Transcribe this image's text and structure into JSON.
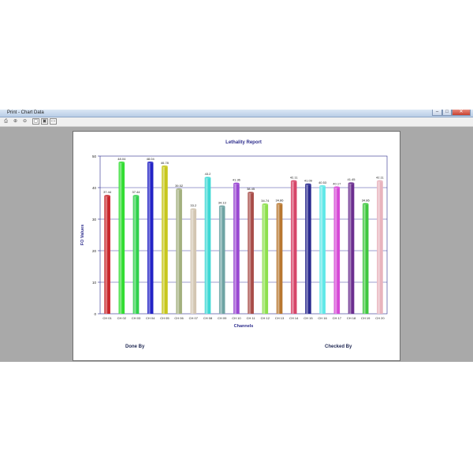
{
  "window": {
    "title": "Print - Chart Data"
  },
  "caption_buttons": {
    "minimize": "–",
    "maximize": "□",
    "close": "✕"
  },
  "toolbar": {
    "buttons": [
      {
        "name": "print-icon",
        "glyph": "⎙"
      },
      {
        "name": "zoom-in-icon",
        "glyph": "⊕"
      },
      {
        "name": "zoom-out-icon",
        "glyph": "⊖"
      },
      {
        "name": "one-page-icon",
        "glyph": "▢"
      },
      {
        "name": "two-page-icon",
        "glyph": "▣"
      },
      {
        "name": "close-preview-icon",
        "glyph": "▭"
      }
    ]
  },
  "footer": {
    "done_by": "Done By",
    "checked_by": "Checked By"
  },
  "chart_data": {
    "type": "bar",
    "title": "Lethality Report",
    "xlabel": "Channels",
    "ylabel": "FO Values",
    "ylim": [
      0,
      50
    ],
    "yticks": [
      0,
      10,
      20,
      30,
      40,
      50
    ],
    "grid": true,
    "categories": [
      "CH 01",
      "CH 02",
      "CH 03",
      "CH 04",
      "CH 05",
      "CH 06",
      "CH 07",
      "CH 08",
      "CH 09",
      "CH 10",
      "CH 11",
      "CH 12",
      "CH 13",
      "CH 14",
      "CH 15",
      "CH 16",
      "CH 17",
      "CH 18",
      "CH 19",
      "CH 20"
    ],
    "values": [
      37.44,
      48.04,
      37.44,
      48.04,
      46.78,
      39.52,
      33.2,
      43.2,
      34.13,
      41.36,
      38.45,
      34.74,
      34.86,
      42.11,
      41.09,
      40.53,
      40.17,
      41.45,
      34.86,
      42.11
    ],
    "labels": [
      "37.44",
      "48.04",
      "37.44",
      "48.04",
      "46.78",
      "39.52",
      "33.2",
      "43.2",
      "34.13",
      "41.36",
      "38.45",
      "34.74",
      "34.86",
      "42.11",
      "41.09",
      "40.53",
      "40.17",
      "41.45",
      "34.86",
      "42.11"
    ],
    "colors": [
      "#c8262b",
      "#33dd33",
      "#2fd14b",
      "#2323c6",
      "#c7c71c",
      "#a3b07e",
      "#d3c6b2",
      "#3fd9d5",
      "#6ea3a3",
      "#9a48d2",
      "#a84c48",
      "#8de04c",
      "#b8772f",
      "#d64468",
      "#2b2b8f",
      "#5fe8e8",
      "#d649d6",
      "#6b2e8f",
      "#3fc73f",
      "#e8b3bd"
    ]
  }
}
